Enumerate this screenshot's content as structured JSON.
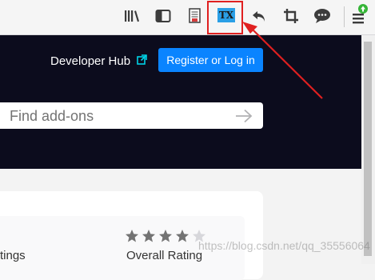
{
  "toolbar": {
    "buttons": [
      {
        "name": "library-icon"
      },
      {
        "name": "sidebar-icon"
      },
      {
        "name": "reader-pdf-icon"
      },
      {
        "name": "tx-extension-icon",
        "label": "TX"
      },
      {
        "name": "undo-icon"
      },
      {
        "name": "crop-icon"
      },
      {
        "name": "chat-icon"
      },
      {
        "name": "menu-icon"
      }
    ],
    "tx_label": "TX",
    "highlight_color": "#e02020",
    "update_badge_color": "#36b538"
  },
  "header": {
    "developer_hub": "Developer Hub",
    "register_label": "Register or Log in",
    "accent": "#0a84ff",
    "background": "#0c0c1d"
  },
  "search": {
    "placeholder": "Find add-ons"
  },
  "ratings": {
    "left_label": "tings",
    "overall_label": "Overall Rating",
    "stars": {
      "filled": 4,
      "total": 5
    }
  },
  "watermark": "https://blog.csdn.net/qq_35556064"
}
